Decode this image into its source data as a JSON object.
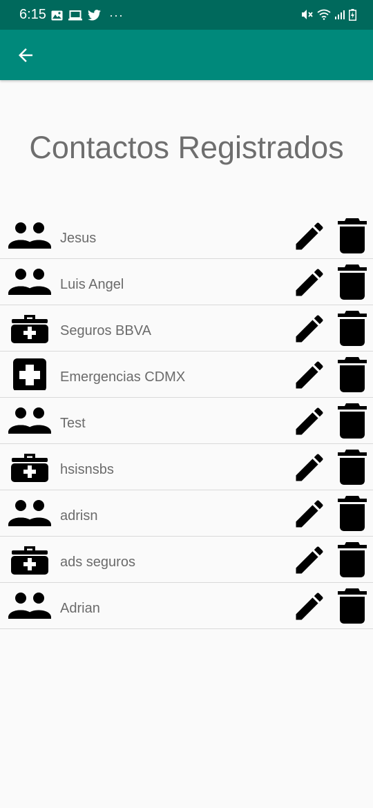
{
  "status_bar": {
    "time": "6:15",
    "left_icons": [
      "gallery-icon",
      "laptop-icon",
      "twitter-icon"
    ],
    "more_indicator": "···",
    "right_icons": [
      "mute-icon",
      "wifi-icon",
      "signal-icon",
      "battery-icon"
    ]
  },
  "app_bar": {
    "back_icon": "arrow-left-icon",
    "color": "#00897b",
    "status_color": "#00695c"
  },
  "title": "Contactos Registrados",
  "contacts": [
    {
      "name": "Jesus",
      "type": "people-icon"
    },
    {
      "name": "Luis Angel",
      "type": "people-icon"
    },
    {
      "name": "Seguros BBVA",
      "type": "medical-kit-icon"
    },
    {
      "name": "Emergencias CDMX",
      "type": "hospital-cross-icon"
    },
    {
      "name": "Test",
      "type": "people-icon"
    },
    {
      "name": "hsisnsbs",
      "type": "medical-kit-icon"
    },
    {
      "name": "adrisn",
      "type": "people-icon"
    },
    {
      "name": "ads seguros",
      "type": "medical-kit-icon"
    },
    {
      "name": "Adrian",
      "type": "people-icon"
    }
  ],
  "row_actions": {
    "edit_icon": "pencil-icon",
    "delete_icon": "trash-icon"
  }
}
